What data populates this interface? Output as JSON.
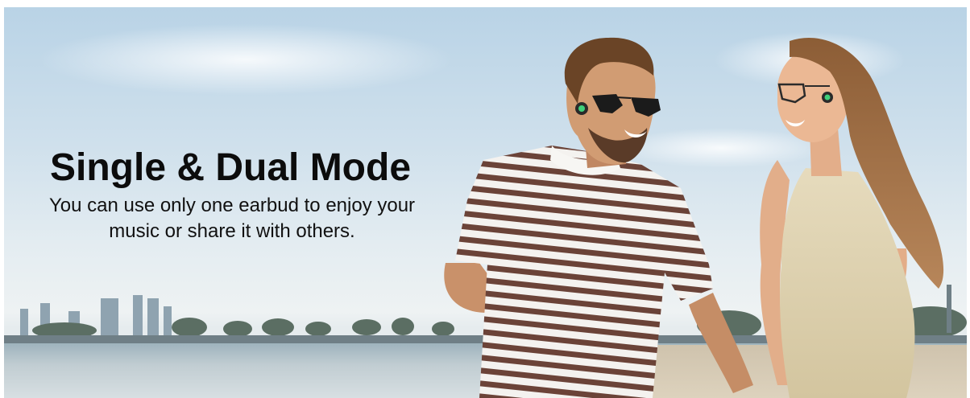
{
  "banner": {
    "headline": "Single & Dual Mode",
    "subtext_line1": "You can use only one earbud to enjoy your",
    "subtext_line2": "music or share it with others."
  },
  "colors": {
    "text": "#0c0c0c",
    "sky": "#b9d3e6",
    "water": "#9eb3bd",
    "stripe": "#6b4338",
    "earbud_light": "#3fd07a"
  }
}
